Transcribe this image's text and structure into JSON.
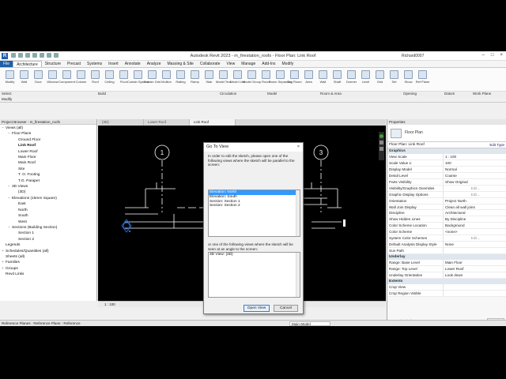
{
  "title": "Autodesk Revit 2023 - m_firestation_roofs - Floor Plan: Link  Roof",
  "user": "Richard0007",
  "ribbon_tabs": [
    "File",
    "Architecture",
    "Structure",
    "Precast",
    "Systems",
    "Insert",
    "Annotate",
    "Analyze",
    "Massing & Site",
    "Collaborate",
    "View",
    "Manage",
    "Add-Ins",
    "Modify"
  ],
  "ribbon_tools": [
    "Modify",
    "Wall",
    "Door",
    "Window",
    "Component",
    "Column",
    "Roof",
    "Ceiling",
    "Floor",
    "Curtain System",
    "Curtain Grid",
    "Mullion",
    "Railing",
    "Ramp",
    "Stair",
    "Model Text",
    "Model Line",
    "Model Group",
    "Room",
    "Room Separator",
    "Tag Room",
    "Area",
    "Wall",
    "Shaft",
    "Dormer",
    "Level",
    "Grid",
    "Set",
    "Show",
    "Ref Plane"
  ],
  "ribbon_panels": [
    "Select",
    "Build",
    "Circulation",
    "Model",
    "Room & Area",
    "Opening",
    "Datum",
    "Work Plane"
  ],
  "options_bar": "Modify",
  "project_browser": {
    "title": "Project Browser - m_firestation_roofs",
    "items": [
      {
        "label": "Views (all)",
        "toggle": "−",
        "level": 0
      },
      {
        "label": "Floor Plans",
        "toggle": "−",
        "level": 1
      },
      {
        "label": "Ground Floor",
        "toggle": "",
        "level": 2
      },
      {
        "label": "Link  Roof",
        "toggle": "",
        "level": 2,
        "bold": true
      },
      {
        "label": "Lower Roof",
        "toggle": "",
        "level": 2
      },
      {
        "label": "Main Floor",
        "toggle": "",
        "level": 2
      },
      {
        "label": "Main Roof",
        "toggle": "",
        "level": 2
      },
      {
        "label": "Site",
        "toggle": "",
        "level": 2
      },
      {
        "label": "T. O. Footing",
        "toggle": "",
        "level": 2
      },
      {
        "label": "T.O. Parapet",
        "toggle": "",
        "level": 2
      },
      {
        "label": "3D Views",
        "toggle": "−",
        "level": 1
      },
      {
        "label": "{3D}",
        "toggle": "",
        "level": 2
      },
      {
        "label": "Elevations (15mm Square)",
        "toggle": "−",
        "level": 1
      },
      {
        "label": "East",
        "toggle": "",
        "level": 2
      },
      {
        "label": "North",
        "toggle": "",
        "level": 2
      },
      {
        "label": "South",
        "toggle": "",
        "level": 2
      },
      {
        "label": "West",
        "toggle": "",
        "level": 2
      },
      {
        "label": "Sections (Building Section)",
        "toggle": "−",
        "level": 1
      },
      {
        "label": "Section 1",
        "toggle": "",
        "level": 2
      },
      {
        "label": "Section 2",
        "toggle": "",
        "level": 2
      },
      {
        "label": "Legends",
        "toggle": "",
        "level": 0
      },
      {
        "label": "Schedules/Quantities (all)",
        "toggle": "+",
        "level": 0
      },
      {
        "label": "Sheets (all)",
        "toggle": "",
        "level": 0
      },
      {
        "label": "Families",
        "toggle": "+",
        "level": 0
      },
      {
        "label": "Groups",
        "toggle": "+",
        "level": 0
      },
      {
        "label": "Revit Links",
        "toggle": "",
        "level": 0
      }
    ]
  },
  "view_tabs": [
    "{3D}",
    "Lower Roof",
    "Link  Roof"
  ],
  "grid_labels": [
    "1",
    "3"
  ],
  "dialog": {
    "title": "Go To View",
    "close": "×",
    "message1": "In order to edit the sketch, please open one of the following views where the sketch will be parallel to the screen:",
    "list1": [
      "Elevation: North",
      "Elevation: South",
      "Section: Section 1",
      "Section: Section 2"
    ],
    "message2": "or one of the following views where the sketch will be seen at an angle to the screen:",
    "list2": [
      "3D View: {3D}"
    ],
    "open_button": "Open View",
    "cancel_button": "Cancel"
  },
  "properties": {
    "title": "Properties",
    "type_name": "Floor Plan",
    "selector": "Floor Plan: Link  Roof",
    "edit_type": "Edit Type",
    "groups": [
      {
        "name": "Graphics",
        "rows": [
          [
            "View Scale",
            "1 : 100"
          ],
          [
            "Scale Value    1:",
            "100"
          ],
          [
            "Display Model",
            "Normal"
          ],
          [
            "Detail Level",
            "Coarse"
          ],
          [
            "Parts Visibility",
            "Show Original"
          ],
          [
            "Visibility/Graphics Overrides",
            "Edit..."
          ],
          [
            "Graphic Display Options",
            "Edit..."
          ],
          [
            "Orientation",
            "Project North"
          ],
          [
            "Wall Join Display",
            "Clean all wall joins"
          ],
          [
            "Discipline",
            "Architectural"
          ],
          [
            "Show Hidden Lines",
            "By Discipline"
          ],
          [
            "Color Scheme Location",
            "Background"
          ],
          [
            "Color Scheme",
            "<none>"
          ],
          [
            "System Color Schemes",
            "Edit..."
          ],
          [
            "Default Analysis Display Style",
            "None"
          ],
          [
            "Sun Path",
            ""
          ]
        ]
      },
      {
        "name": "Underlay",
        "rows": [
          [
            "Range: Base Level",
            "Main Floor"
          ],
          [
            "Range: Top Level",
            "Lower Roof"
          ],
          [
            "Underlay Orientation",
            "Look down"
          ]
        ]
      },
      {
        "name": "Extents",
        "rows": [
          [
            "Crop View",
            ""
          ],
          [
            "Crop Region Visible",
            ""
          ]
        ]
      }
    ],
    "help": "Properties help",
    "apply": "Apply"
  },
  "view_control_bar": "1 : 100",
  "status_bar": "Reference Planes : Reference Plane : Reference",
  "status_model": "Main Model",
  "accent_color": "#1f5fa8",
  "selection_color": "#3399ff"
}
